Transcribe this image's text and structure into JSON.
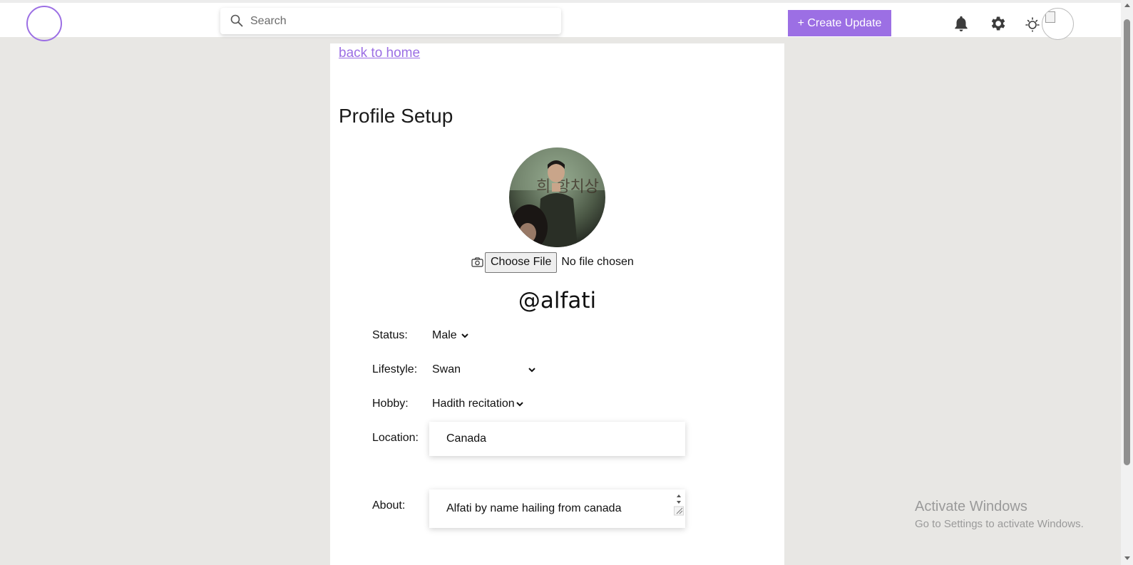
{
  "header": {
    "search_placeholder": "Search",
    "create_button": "+ Create Update",
    "accent_color": "#9c6fe4",
    "icons": [
      "bell-icon",
      "gear-icon",
      "sun-icon"
    ]
  },
  "main": {
    "back_link": "back to home",
    "title": "Profile Setup",
    "file_button": "Choose File",
    "file_status": "No file chosen",
    "username": "@alfati",
    "fields": {
      "status": {
        "label": "Status:",
        "value": "Male"
      },
      "lifestyle": {
        "label": "Lifestyle:",
        "value": "Swan"
      },
      "hobby": {
        "label": "Hobby:",
        "value": "Hadith recitation"
      },
      "location": {
        "label": "Location:",
        "value": "Canada"
      },
      "about": {
        "label": "About:",
        "value": "Alfati by name hailing from canada"
      }
    }
  },
  "watermark": {
    "line1": "Activate Windows",
    "line2": "Go to Settings to activate Windows."
  }
}
